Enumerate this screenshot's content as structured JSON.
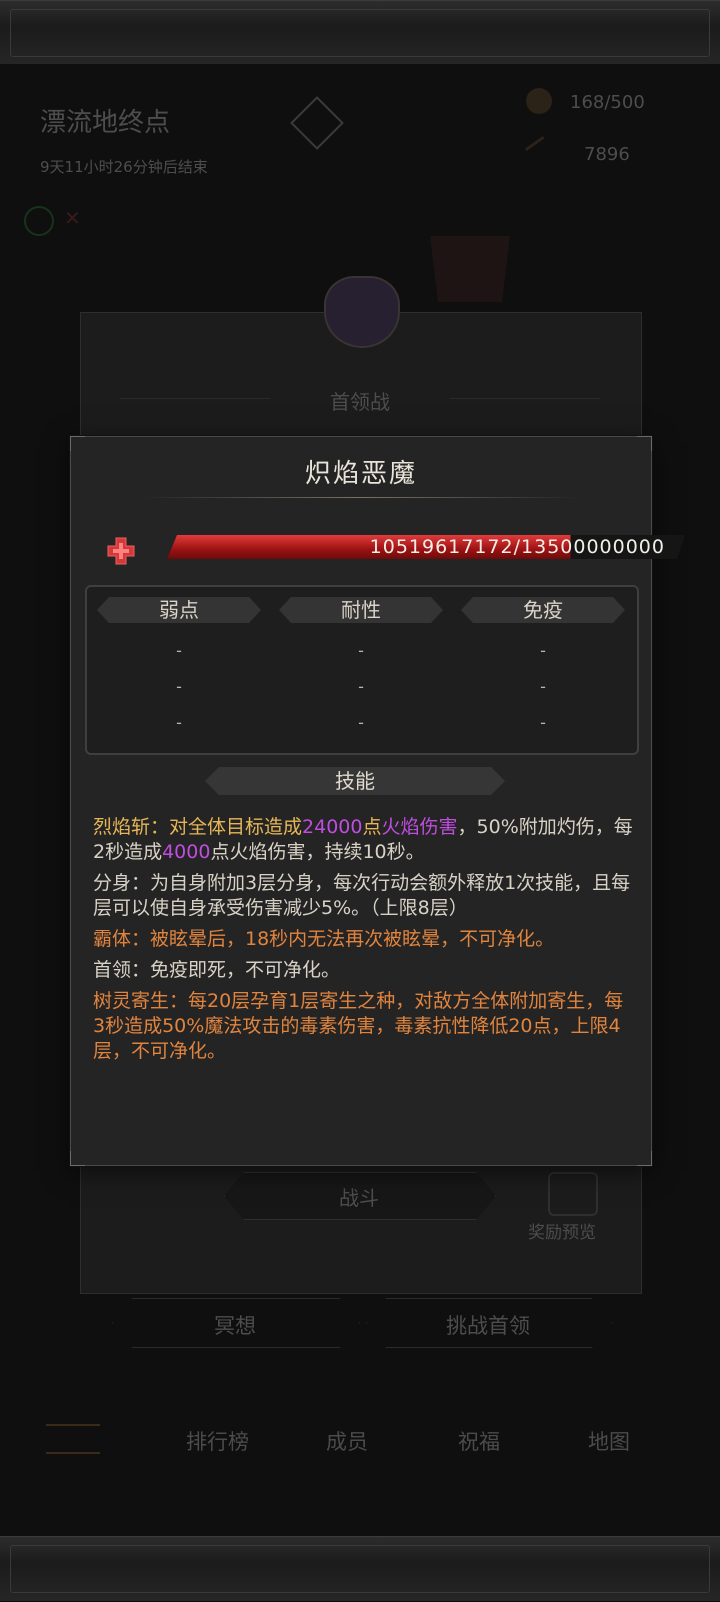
{
  "background": {
    "event_title": "漂流地终点",
    "event_timer": "9天11小时26分钟后结束",
    "resource_1": "168/500",
    "resource_2": "7896",
    "panel_title": "首领战",
    "battle_button": "战斗",
    "reward_preview": "奖励预览",
    "meditate_button": "冥想",
    "challenge_button": "挑战首领",
    "nav_items": [
      "排行榜",
      "成员",
      "祝福",
      "地图"
    ]
  },
  "modal": {
    "boss_name": "炽焰恶魔",
    "hp_text": "10519617172/13500000000",
    "hp_fraction": 0.779,
    "columns": [
      {
        "label": "弱点",
        "values": [
          "-",
          "-",
          "-"
        ]
      },
      {
        "label": "耐性",
        "values": [
          "-",
          "-",
          "-"
        ]
      },
      {
        "label": "免疫",
        "values": [
          "-",
          "-",
          "-"
        ]
      }
    ],
    "skills_header": "技能",
    "skills": {
      "s1_name": "烈焰斩：",
      "s1_a": "对全体目标造成",
      "s1_num1": "24000",
      "s1_b": "点",
      "s1_type": "火焰伤害",
      "s1_c": "，50%附加灼伤，每2秒造成",
      "s1_num2": "4000",
      "s1_d": "点火焰伤害，持续10秒。",
      "s2": "分身：为自身附加3层分身，每次行动会额外释放1次技能，且每层可以使自身承受伤害减少5%。（上限8层）",
      "s3": "霸体：被眩晕后，18秒内无法再次被眩晕，不可净化。",
      "s4": "首领：免疫即死，不可净化。",
      "s5": "树灵寄生：每20层孕育1层寄生之种，对敌方全体附加寄生，每3秒造成50%魔法攻击的毒素伤害，毒素抗性降低20点，上限4层，不可净化。"
    }
  },
  "colors": {
    "hp_red": "#c21a1a",
    "orange": "#e0843e",
    "purple": "#c04de0",
    "gold": "#e6b657"
  }
}
